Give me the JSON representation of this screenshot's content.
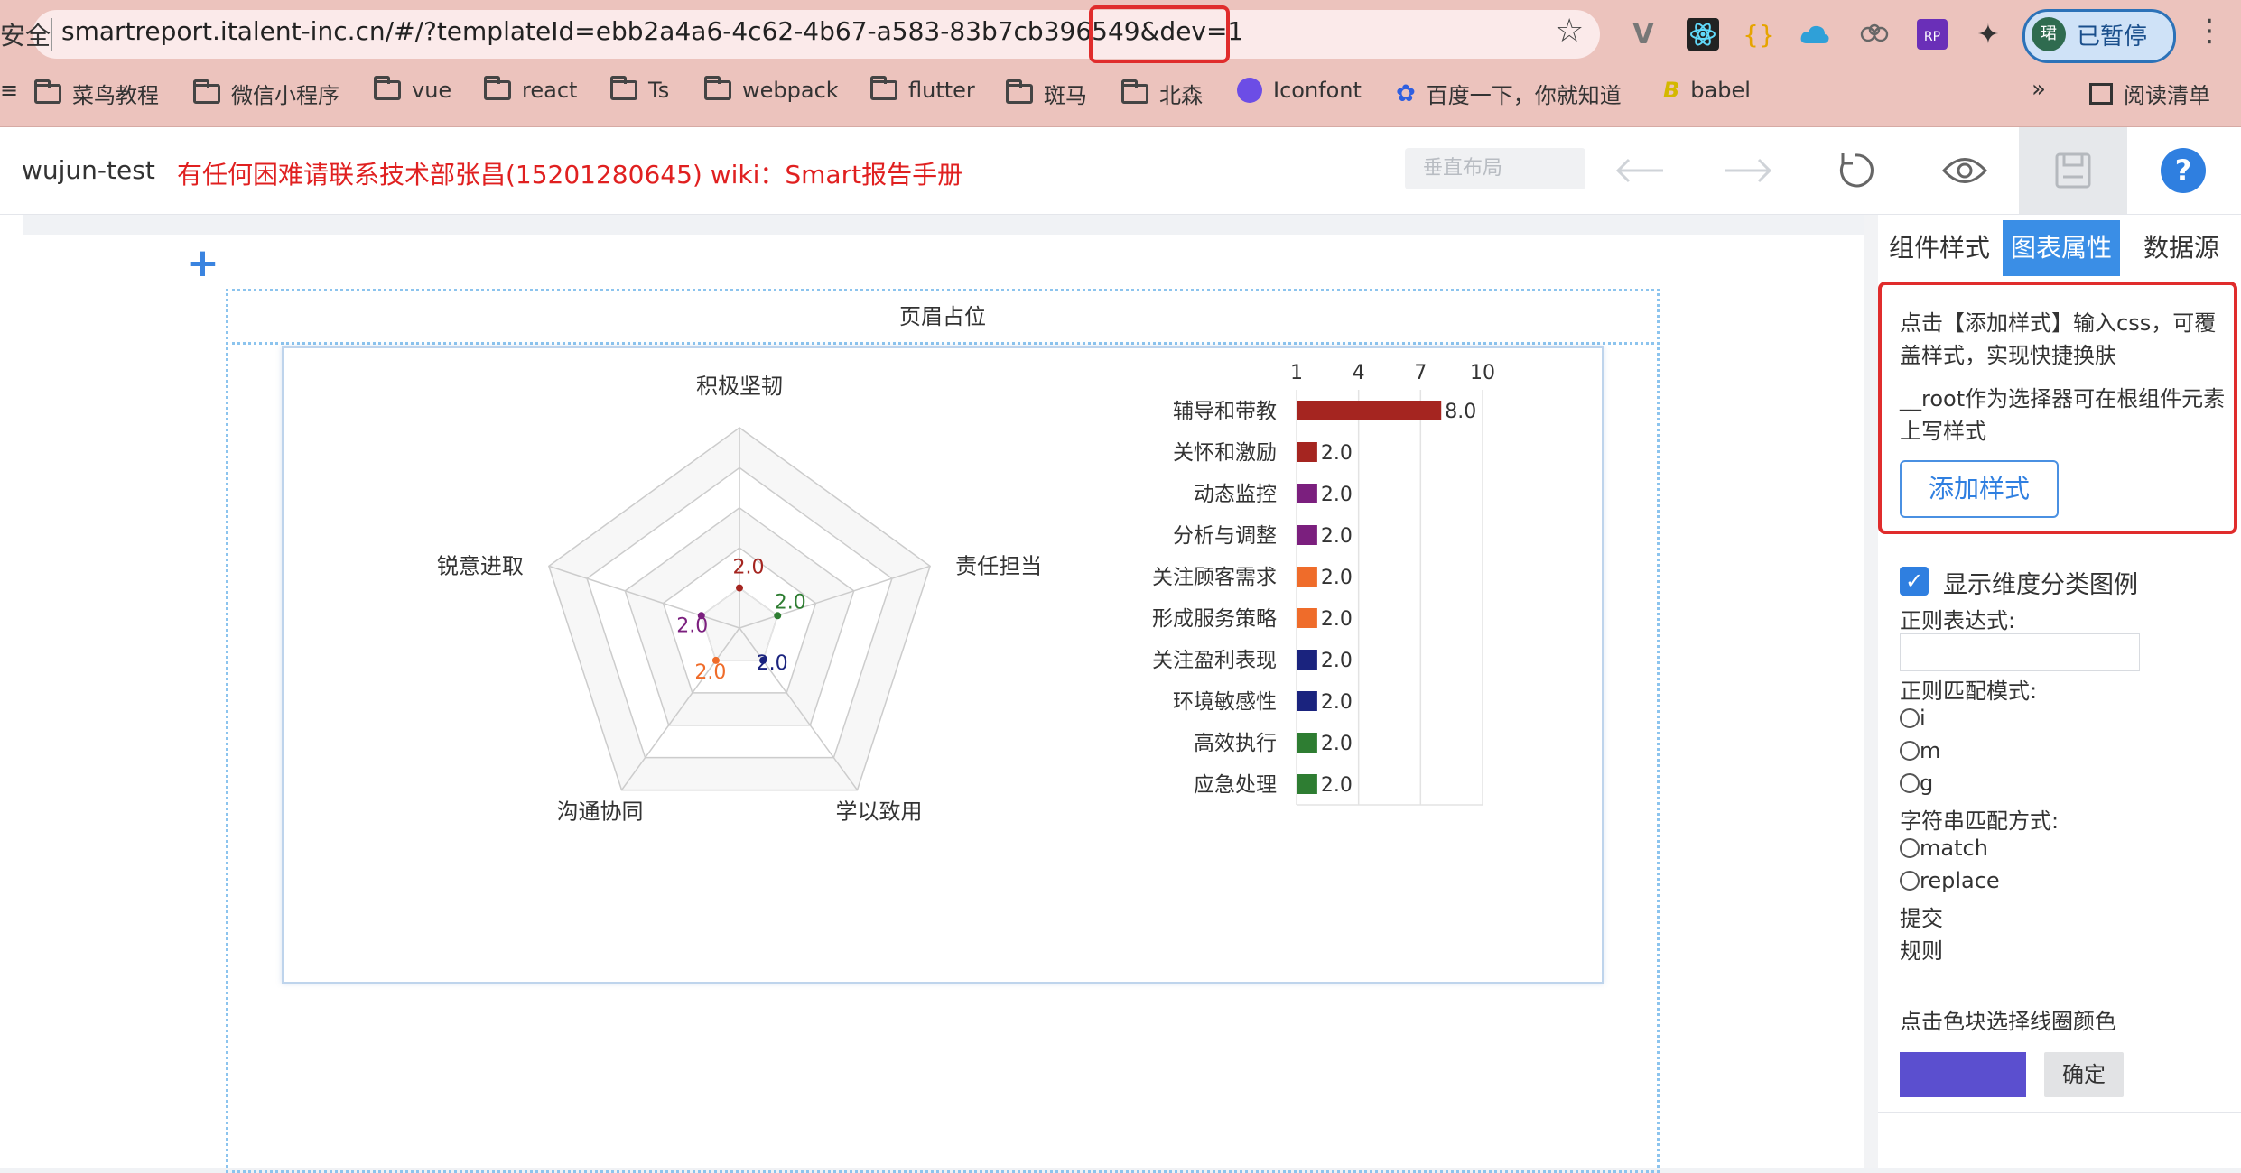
{
  "browser": {
    "security_label": "安全",
    "url": "smartreport.italent-inc.cn/#/?templateId=ebb2a4a6-4c62-4b67-a583-83b7cb396549&dev=1",
    "url_main": "smartreport.italent-inc.cn/#/?templateId=ebb2a4a6-4c62-4b67-a583-83b7cb39654",
    "url_tail": "9&dev=1",
    "profile_initial": "珺",
    "profile_status": "已暂停",
    "bookmarks": [
      "菜鸟教程",
      "微信小程序",
      "vue",
      "react",
      "Ts",
      "webpack",
      "flutter",
      "斑马",
      "北森",
      "Iconfont",
      "百度一下，你就知道",
      "babel"
    ],
    "bookmarks_more": "»",
    "reading_list": "阅读清单",
    "accent_highlight": "#e02c2c"
  },
  "header": {
    "app_name": "wujun-test",
    "notice": "有任何困难请联系技术部张昌(15201280645) wiki：Smart报告手册",
    "layout_select": "垂直布局",
    "help": "?"
  },
  "canvas": {
    "add": "+",
    "header_placeholder": "页眉占位"
  },
  "chart_data": [
    {
      "type": "radar",
      "indicators": [
        "积极坚韧",
        "责任担当",
        "学以致用",
        "沟通协同",
        "锐意进取"
      ],
      "max": 10,
      "values": [
        2.0,
        2.0,
        2.0,
        2.0,
        2.0
      ],
      "value_labels": [
        "2.0",
        "2.0",
        "2.0",
        "2.0",
        "2.0"
      ],
      "point_colors": [
        "#a52520",
        "#2e7d32",
        "#1a237e",
        "#ef6c2a",
        "#7b1f7e"
      ]
    },
    {
      "type": "bar",
      "orientation": "horizontal",
      "categories": [
        "辅导和带教",
        "关怀和激励",
        "动态监控",
        "分析与调整",
        "关注顾客需求",
        "形成服务策略",
        "关注盈利表现",
        "环境敏感性",
        "高效执行",
        "应急处理"
      ],
      "values": [
        8.0,
        2.0,
        2.0,
        2.0,
        2.0,
        2.0,
        2.0,
        2.0,
        2.0,
        2.0
      ],
      "value_labels": [
        "8.0",
        "2.0",
        "2.0",
        "2.0",
        "2.0",
        "2.0",
        "2.0",
        "2.0",
        "2.0",
        "2.0"
      ],
      "colors": [
        "#a52520",
        "#a52520",
        "#7b1f7e",
        "#7b1f7e",
        "#ef6c2a",
        "#ef6c2a",
        "#1a237e",
        "#1a237e",
        "#2e7d32",
        "#2e7d32"
      ],
      "xticks": [
        "1",
        "4",
        "7",
        "10"
      ],
      "xlim": [
        1,
        10
      ]
    }
  ],
  "panel": {
    "tabs": [
      {
        "label": "组件样式",
        "active": false
      },
      {
        "label": "图表属性",
        "active": true
      },
      {
        "label": "数据源",
        "active": false
      }
    ],
    "help_line1": "点击【添加样式】输入css，可覆盖样式，实现快捷换肤",
    "help_line2": "__root作为选择器可在根组件元素上写样式",
    "add_style": "添加样式",
    "show_legend": "显示维度分类图例",
    "regex_label": "正则表达式:",
    "regex_value": "",
    "regex_mode_label": "正则匹配模式:",
    "regex_modes": [
      "i",
      "m",
      "g"
    ],
    "match_mode_label": "字符串匹配方式:",
    "match_modes": [
      "match",
      "replace"
    ],
    "submit": "提交",
    "rules": "规则",
    "color_hint": "点击色块选择线圈颜色",
    "swatch_color": "#5b4fcf",
    "confirm": "确定",
    "active_tab_color": "#3a8ee6"
  }
}
